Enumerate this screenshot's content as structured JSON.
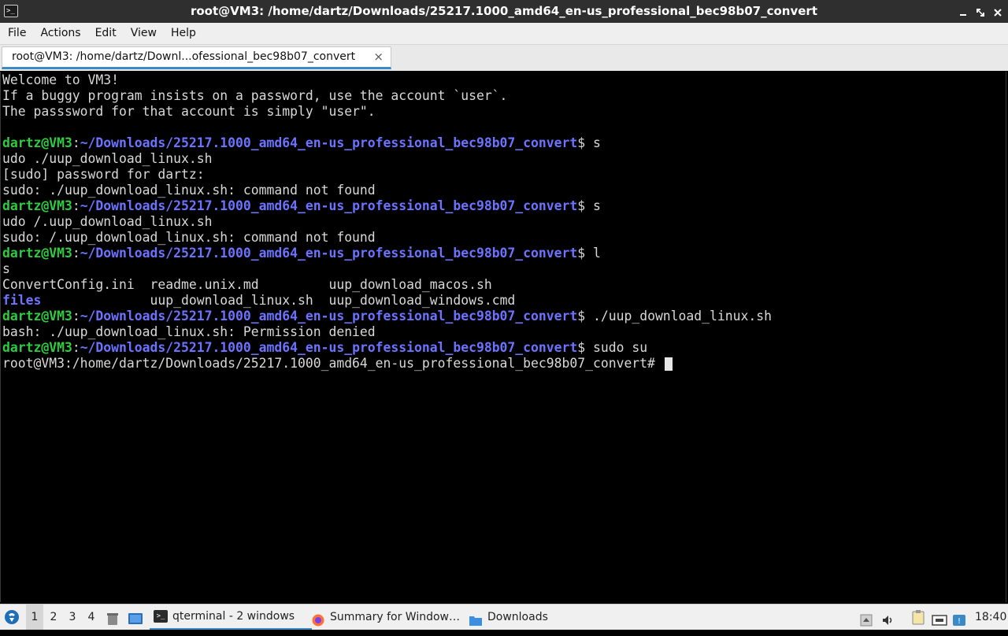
{
  "window": {
    "title": "root@VM3: /home/dartz/Downloads/25217.1000_amd64_en-us_professional_bec98b07_convert",
    "app_icon_glyph": ">_"
  },
  "menu": [
    "File",
    "Actions",
    "Edit",
    "View",
    "Help"
  ],
  "tab": {
    "label": "root@VM3: /home/dartz/Downl...ofessional_bec98b07_convert",
    "close_glyph": "×"
  },
  "terminal": {
    "welcome": [
      "Welcome to VM3!",
      "If a buggy program insists on a password, use the account `user`.",
      "The passsword for that account is simply \"user\"."
    ],
    "prompt_user": "dartz@VM3",
    "prompt_colon": ":",
    "prompt_path": "~/Downloads/25217.1000_amd64_en-us_professional_bec98b07_convert",
    "prompt_sign": "$ ",
    "cmd1": "s",
    "out1": [
      "udo ./uup_download_linux.sh",
      "[sudo] password for dartz:",
      "sudo: ./uup_download_linux.sh: command not found"
    ],
    "cmd2": "s",
    "out2": [
      "udo /.uup_download_linux.sh",
      "sudo: /.uup_download_linux.sh: command not found"
    ],
    "cmd3": "l",
    "out3": [
      "s"
    ],
    "ls_row1": {
      "c1": "ConvertConfig.ini  ",
      "c2": "readme.unix.md         ",
      "c3": "uup_download_macos.sh"
    },
    "ls_row2": {
      "c1": "files",
      "c1_pad": "              ",
      "c2": "uup_download_linux.sh  ",
      "c3": "uup_download_windows.cmd"
    },
    "cmd4": "./uup_download_linux.sh",
    "out4": [
      "bash: ./uup_download_linux.sh: Permission denied"
    ],
    "cmd5": "sudo su",
    "root_prompt": "root@VM3:/home/dartz/Downloads/25217.1000_amd64_en-us_professional_bec98b07_convert# "
  },
  "colors": {
    "prompt_user": "#2ecc40",
    "prompt_path": "#6b73ff",
    "accent": "#3b8ac6"
  },
  "taskbar": {
    "workspaces": [
      "1",
      "2",
      "3",
      "4"
    ],
    "active_workspace": "1",
    "tasks": [
      {
        "label": "qterminal - 2 windows",
        "icon": "terminal-icon",
        "active": true
      },
      {
        "label": "Summary for Window…",
        "icon": "firefox-icon",
        "active": false
      },
      {
        "label": "Downloads",
        "icon": "folder-icon",
        "active": false
      }
    ],
    "clock": "18:40"
  }
}
